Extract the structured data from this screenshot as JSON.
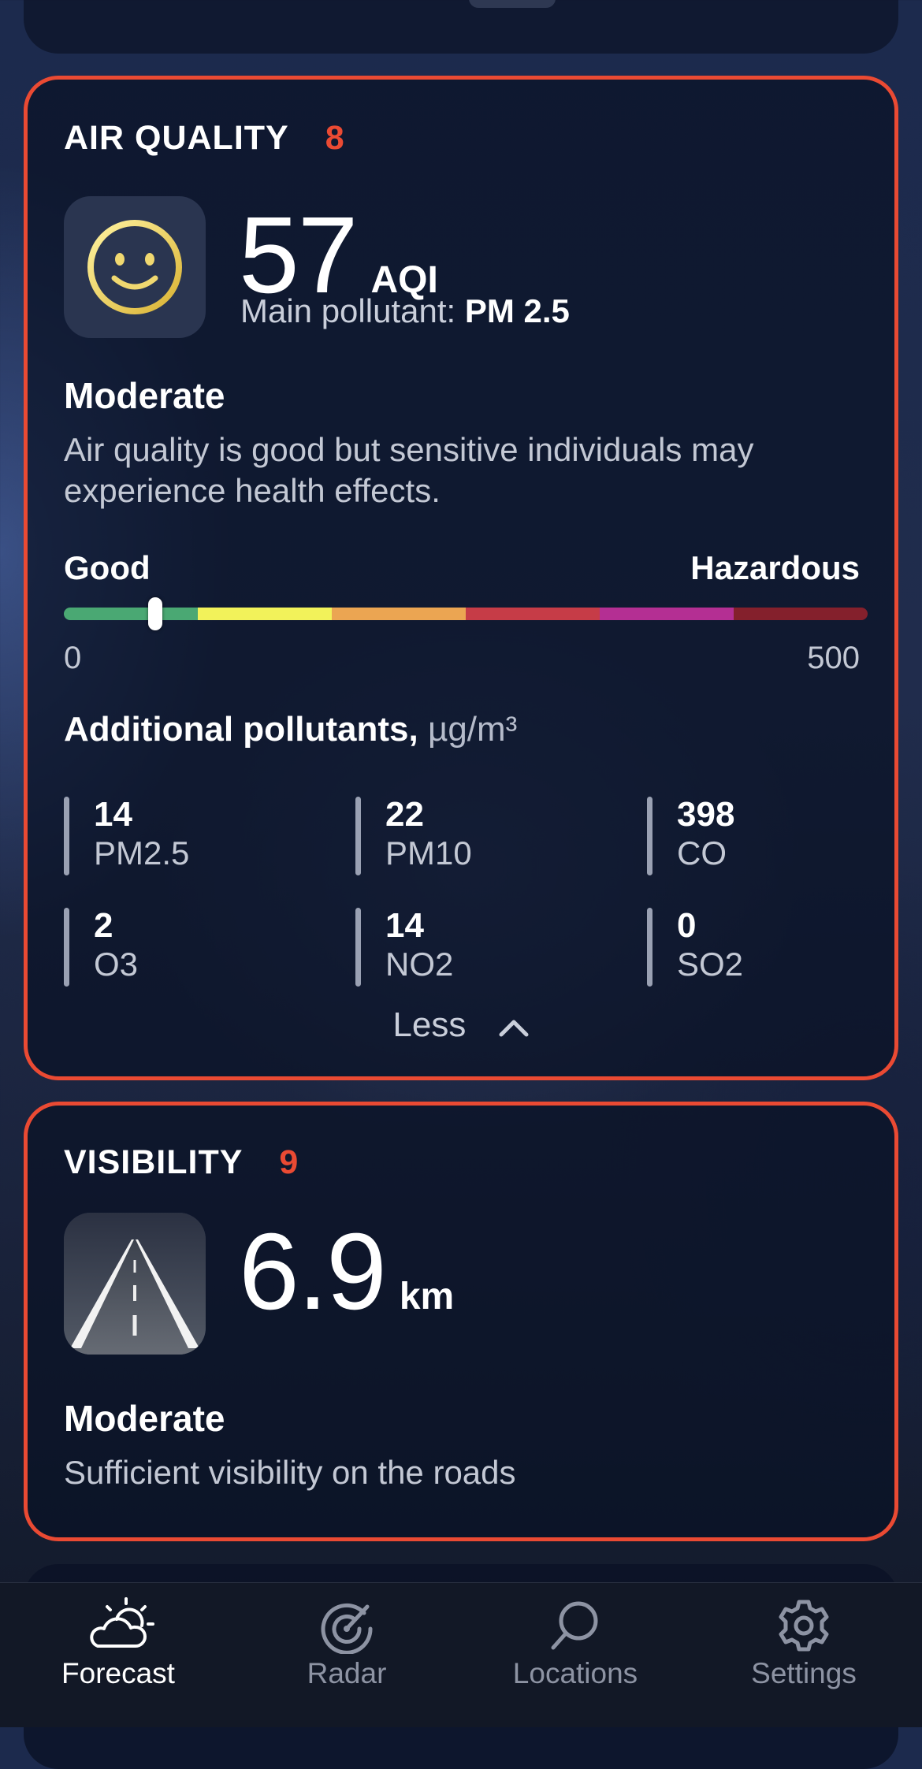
{
  "air_quality": {
    "title": "AIR QUALITY",
    "badge": "8",
    "icon": "smiley-face-icon",
    "value": "57",
    "unit": "AQI",
    "main_pollutant_label": "Main pollutant:",
    "main_pollutant_value": "PM 2.5",
    "category": "Moderate",
    "description": "Air quality is good but sensitive individuals may experience health effects.",
    "scale": {
      "low_label": "Good",
      "high_label": "Hazardous",
      "min": "0",
      "max": "500",
      "current": 57,
      "segment_colors": [
        "#4aa873",
        "#f2f25a",
        "#eba552",
        "#c63c47",
        "#b42f93",
        "#84202c"
      ]
    },
    "additional_title": "Additional pollutants,",
    "additional_unit": "µg/m³",
    "pollutants": [
      {
        "value": "14",
        "name": "PM2.5"
      },
      {
        "value": "22",
        "name": "PM10"
      },
      {
        "value": "398",
        "name": "CO"
      },
      {
        "value": "2",
        "name": "O3"
      },
      {
        "value": "14",
        "name": "NO2"
      },
      {
        "value": "0",
        "name": "SO2"
      }
    ],
    "toggle_label": "Less"
  },
  "visibility": {
    "title": "VISIBILITY",
    "badge": "9",
    "icon": "road-icon",
    "value": "6.9",
    "unit": "km",
    "category": "Moderate",
    "description": "Sufficient visibility on the roads"
  },
  "tabbar": {
    "items": [
      {
        "label": "Forecast",
        "icon": "cloud-sun-icon",
        "active": true
      },
      {
        "label": "Radar",
        "icon": "radar-icon",
        "active": false
      },
      {
        "label": "Locations",
        "icon": "search-icon",
        "active": false
      },
      {
        "label": "Settings",
        "icon": "gear-icon",
        "active": false
      }
    ]
  },
  "colors": {
    "highlight_border": "#ea4a33",
    "badge": "#ea4a33"
  }
}
